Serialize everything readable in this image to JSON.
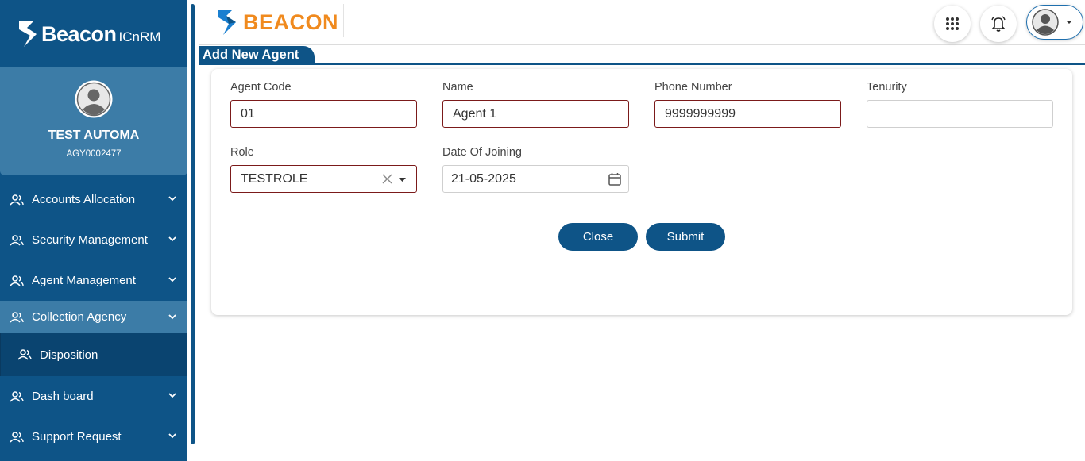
{
  "sidebar": {
    "brand_name": "Beacon",
    "brand_sub": "ICnRM",
    "user_name": "TEST AUTOMA",
    "user_code": "AGY0002477",
    "menu": [
      {
        "label": "Accounts Allocation"
      },
      {
        "label": "Security Management"
      },
      {
        "label": "Agent Management"
      },
      {
        "label": "Collection Agency"
      },
      {
        "label": "Disposition"
      },
      {
        "label": "Dash board"
      },
      {
        "label": "Support Request"
      }
    ]
  },
  "header": {
    "logo_text": "BEACON",
    "icons": [
      "apps-grid-icon",
      "bell-icon",
      "user-avatar-icon"
    ]
  },
  "page_title": "Add New Agent",
  "form": {
    "agent_code": {
      "label": "Agent Code",
      "value": "01"
    },
    "name": {
      "label": "Name",
      "value": "Agent 1"
    },
    "phone": {
      "label": "Phone Number",
      "value": "9999999999"
    },
    "tenurity": {
      "label": "Tenurity",
      "value": ""
    },
    "role": {
      "label": "Role",
      "value": "TESTROLE"
    },
    "doj": {
      "label": "Date Of Joining",
      "value": "21-05-2025"
    }
  },
  "buttons": {
    "close": "Close",
    "submit": "Submit"
  },
  "colors": {
    "primary": "#0e5487",
    "sidebar_highlight": "#3c7ca7",
    "logo_orange": "#f08a1e",
    "logo_blue": "#1a7fd0",
    "error_border": "#7b1a1a"
  }
}
